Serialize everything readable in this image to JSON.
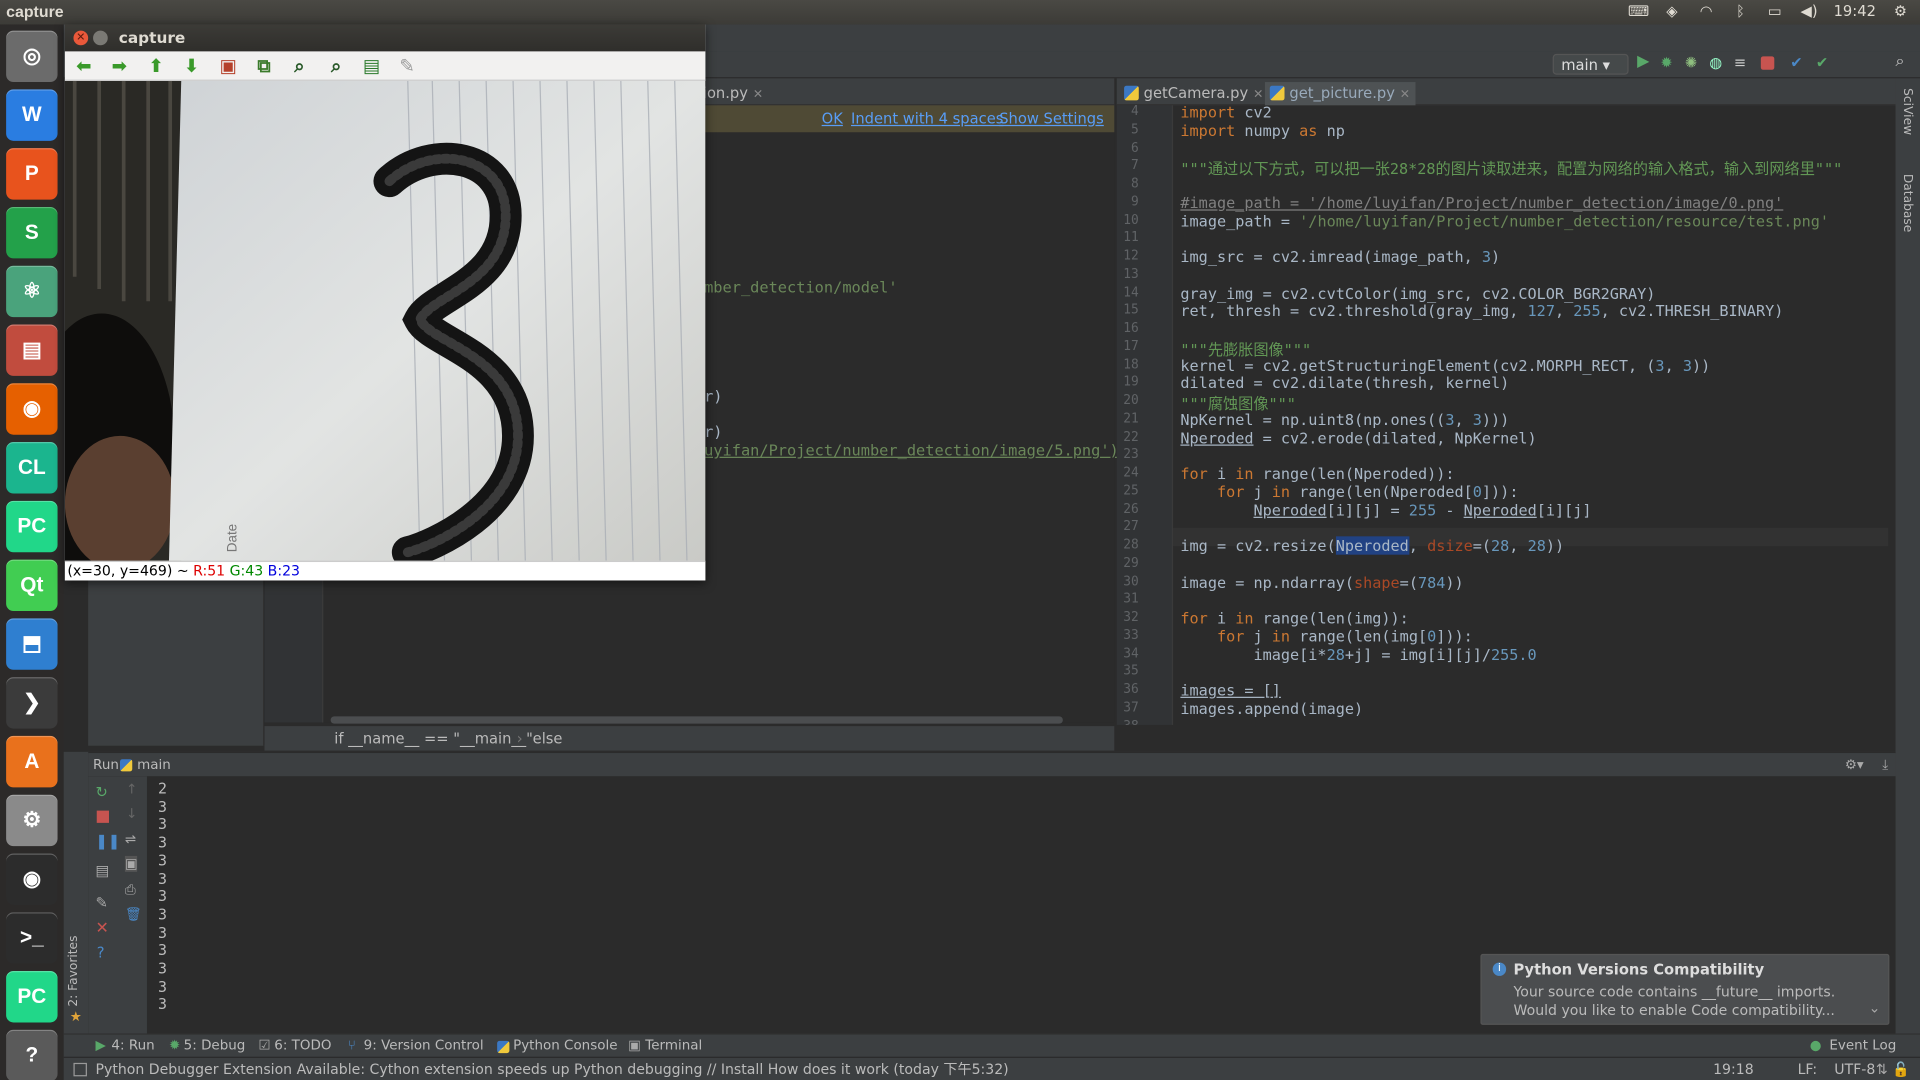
{
  "os": {
    "top_title": "capture",
    "clock": "19:42",
    "launcher": [
      {
        "name": "ubuntu-dash-icon",
        "glyph": "◎",
        "color": "#6b6b6b"
      },
      {
        "name": "wps-writer-icon",
        "glyph": "W",
        "color": "#2a7de1"
      },
      {
        "name": "wps-presentation-icon",
        "glyph": "P",
        "color": "#e8531d"
      },
      {
        "name": "wps-spreadsheet-icon",
        "glyph": "S",
        "color": "#23a14a"
      },
      {
        "name": "atom-icon",
        "glyph": "⚛",
        "color": "#4aa37c"
      },
      {
        "name": "files-icon",
        "glyph": "▤",
        "color": "#c14c3e"
      },
      {
        "name": "firefox-icon",
        "glyph": "◉",
        "color": "#e66000"
      },
      {
        "name": "clion-icon",
        "glyph": "CL",
        "color": "#1bb58e"
      },
      {
        "name": "pycharm-icon",
        "glyph": "PC",
        "color": "#21d789"
      },
      {
        "name": "qt-creator-icon",
        "glyph": "Qt",
        "color": "#41cd52"
      },
      {
        "name": "install-icon",
        "glyph": "⬒",
        "color": "#2f7fd0"
      },
      {
        "name": "sublime-icon",
        "glyph": "❯",
        "color": "#3b3b3b"
      },
      {
        "name": "software-center-icon",
        "glyph": "A",
        "color": "#e9711c"
      },
      {
        "name": "system-settings-icon",
        "glyph": "⚙",
        "color": "#8a8a8a"
      },
      {
        "name": "camera-icon",
        "glyph": "◉",
        "color": "#2c2c2c"
      },
      {
        "name": "terminal-icon",
        "glyph": ">_",
        "color": "#2c2c2c"
      },
      {
        "name": "pycharm-running-icon",
        "glyph": "PC",
        "color": "#21d789"
      },
      {
        "name": "help-icon",
        "glyph": "?",
        "color": "#5a5a5a"
      }
    ]
  },
  "capture": {
    "title": "capture",
    "status_coord": "(x=30, y=469) ~ ",
    "status_r": "R:51",
    "status_g": "G:43",
    "status_b": "B:23"
  },
  "ide": {
    "run_config": "main",
    "left_tab_partial": "ion.py",
    "notice": {
      "ok": "OK",
      "indent": "Indent with 4 spaces",
      "show": "Show Settings"
    },
    "left_code_lines": [
      "mber_detection/model'",
      "r)",
      "r)",
      "uyifan/Project/number_detection/image/5.png')"
    ],
    "breadcrumb": [
      "if __name__ == \"__main__\"",
      "else"
    ],
    "right_tabs": [
      "getCamera.py",
      "get_picture.py"
    ],
    "code": [
      {
        "n": "4",
        "t": "import cv2"
      },
      {
        "n": "5",
        "t": "import numpy as np"
      },
      {
        "n": "6",
        "t": ""
      },
      {
        "n": "7",
        "t": "\"\"\"通过以下方式，可以把一张28*28的图片读取进来，配置为网络的输入格式，输入到网络里\"\"\""
      },
      {
        "n": "8",
        "t": ""
      },
      {
        "n": "9",
        "t": "#image_path = '/home/luyifan/Project/number_detection/image/0.png'"
      },
      {
        "n": "10",
        "t": "image_path = '/home/luyifan/Project/number_detection/resource/test.png'"
      },
      {
        "n": "11",
        "t": ""
      },
      {
        "n": "12",
        "t": "img_src = cv2.imread(image_path, 3)"
      },
      {
        "n": "13",
        "t": ""
      },
      {
        "n": "14",
        "t": "gray_img = cv2.cvtColor(img_src, cv2.COLOR_BGR2GRAY)"
      },
      {
        "n": "15",
        "t": "ret, thresh = cv2.threshold(gray_img, 127, 255, cv2.THRESH_BINARY)"
      },
      {
        "n": "16",
        "t": ""
      },
      {
        "n": "17",
        "t": "\"\"\"先膨胀图像\"\"\""
      },
      {
        "n": "18",
        "t": "kernel = cv2.getStructuringElement(cv2.MORPH_RECT, (3, 3))"
      },
      {
        "n": "19",
        "t": "dilated = cv2.dilate(thresh, kernel)"
      },
      {
        "n": "20",
        "t": "\"\"\"腐蚀图像\"\"\""
      },
      {
        "n": "21",
        "t": "NpKernel = np.uint8(np.ones((3, 3)))"
      },
      {
        "n": "22",
        "t": "Nperoded = cv2.erode(dilated, NpKernel)"
      },
      {
        "n": "23",
        "t": ""
      },
      {
        "n": "24",
        "t": "for i in range(len(Nperoded)):"
      },
      {
        "n": "25",
        "t": "    for j in range(len(Nperoded[0])):"
      },
      {
        "n": "26",
        "t": "        Nperoded[i][j] = 255 - Nperoded[i][j]"
      },
      {
        "n": "27",
        "t": ""
      },
      {
        "n": "28",
        "t": "img = cv2.resize(Nperoded, dsize=(28, 28))"
      },
      {
        "n": "29",
        "t": ""
      },
      {
        "n": "30",
        "t": "image = np.ndarray(shape=(784))"
      },
      {
        "n": "31",
        "t": ""
      },
      {
        "n": "32",
        "t": "for i in range(len(img)):"
      },
      {
        "n": "33",
        "t": "    for j in range(len(img[0])):"
      },
      {
        "n": "34",
        "t": "        image[i*28+j] = img[i][j]/255.0"
      },
      {
        "n": "35",
        "t": ""
      },
      {
        "n": "36",
        "t": "images = []"
      },
      {
        "n": "37",
        "t": "images.append(image)"
      },
      {
        "n": "38",
        "t": ""
      }
    ],
    "run": {
      "label": "Run",
      "config": "main",
      "output": [
        "2",
        "3",
        "3",
        "3",
        "3",
        "3",
        "3",
        "3",
        "3",
        "3",
        "3",
        "3",
        "3"
      ]
    },
    "favorites": "2: Favorites",
    "bottom_tabs": [
      "4: Run",
      "5: Debug",
      "6: TODO",
      "9: Version Control",
      "Python Console",
      "Terminal"
    ],
    "event_log": "Event Log",
    "status_msg": "Python Debugger Extension Available: Cython extension speeds up Python debugging // Install How does it work (today 下午5:32)",
    "status_pos": "19:18",
    "status_lf": "LF:",
    "status_enc": "UTF-8",
    "side_tabs": [
      "SciView",
      "Database"
    ],
    "notification": {
      "title": "Python Versions Compatibility",
      "line1": "Your source code contains __future__ imports.",
      "line2": "Would you like to enable Code compatibility..."
    }
  }
}
